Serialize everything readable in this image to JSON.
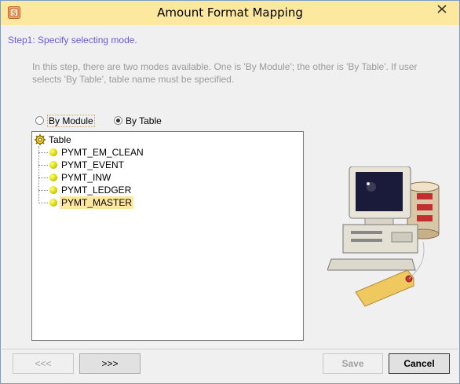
{
  "window": {
    "title": "Amount Format Mapping",
    "app_icon": "app-logo-icon",
    "close_icon": "close-icon"
  },
  "step": {
    "title": "Step1: Specify selecting mode.",
    "description": "In this step, there are two modes available. One is 'By Module'; the other is 'By Table'. If user selects 'By Table', table name must be specified."
  },
  "mode": {
    "options": [
      {
        "label": "By Module",
        "selected": false
      },
      {
        "label": "By Table",
        "selected": true
      }
    ]
  },
  "tree": {
    "root": {
      "label": "Table",
      "icon": "table-gear-icon"
    },
    "items": [
      {
        "label": "PYMT_EM_CLEAN",
        "selected": false
      },
      {
        "label": "PYMT_EVENT",
        "selected": false
      },
      {
        "label": "PYMT_INW",
        "selected": false
      },
      {
        "label": "PYMT_LEDGER",
        "selected": false
      },
      {
        "label": "PYMT_MASTER",
        "selected": true
      }
    ]
  },
  "illustration": {
    "icon": "computer-database-tag-icon"
  },
  "buttons": {
    "back": "<<<",
    "next": ">>>",
    "save": "Save",
    "cancel": "Cancel"
  },
  "colors": {
    "titlebar": "#fce89e",
    "step_text": "#6a5acd",
    "selection": "#ffe7a0"
  }
}
